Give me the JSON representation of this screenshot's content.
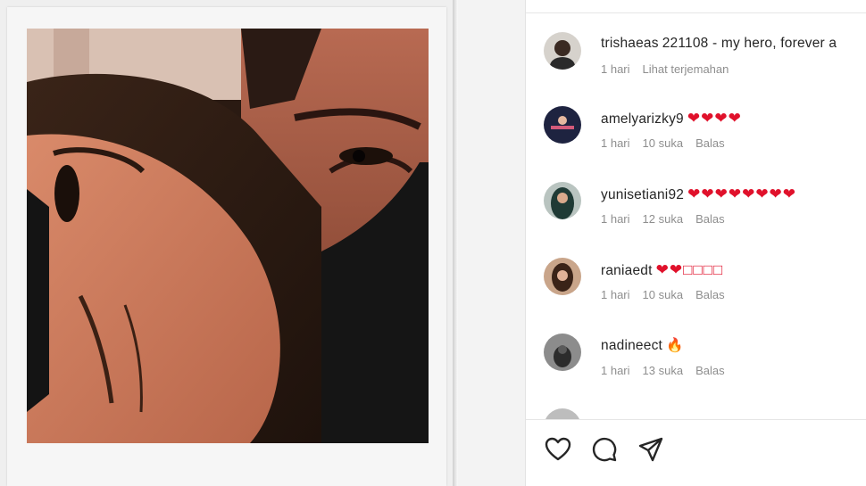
{
  "comments": [
    {
      "user": "trishaeas",
      "text": "221108 - my hero, forever a",
      "meta": [
        "1 hari",
        "Lihat terjemahan"
      ]
    },
    {
      "user": "amelyarizky9",
      "text": "❤❤❤❤",
      "meta": [
        "1 hari",
        "10 suka",
        "Balas"
      ]
    },
    {
      "user": "yunisetiani92",
      "text": "❤❤❤❤❤❤❤❤",
      "meta": [
        "1 hari",
        "12 suka",
        "Balas"
      ]
    },
    {
      "user": "raniaedt",
      "text": "❤❤□□□□",
      "meta": [
        "1 hari",
        "10 suka",
        "Balas"
      ]
    },
    {
      "user": "nadineect",
      "text": "🔥",
      "meta": [
        "1 hari",
        "13 suka",
        "Balas"
      ]
    }
  ],
  "colors": {
    "heart": "#e0112b",
    "muted": "#8e8e8e",
    "text": "#262626"
  },
  "icons": [
    "heart-icon",
    "comment-icon",
    "share-icon"
  ]
}
